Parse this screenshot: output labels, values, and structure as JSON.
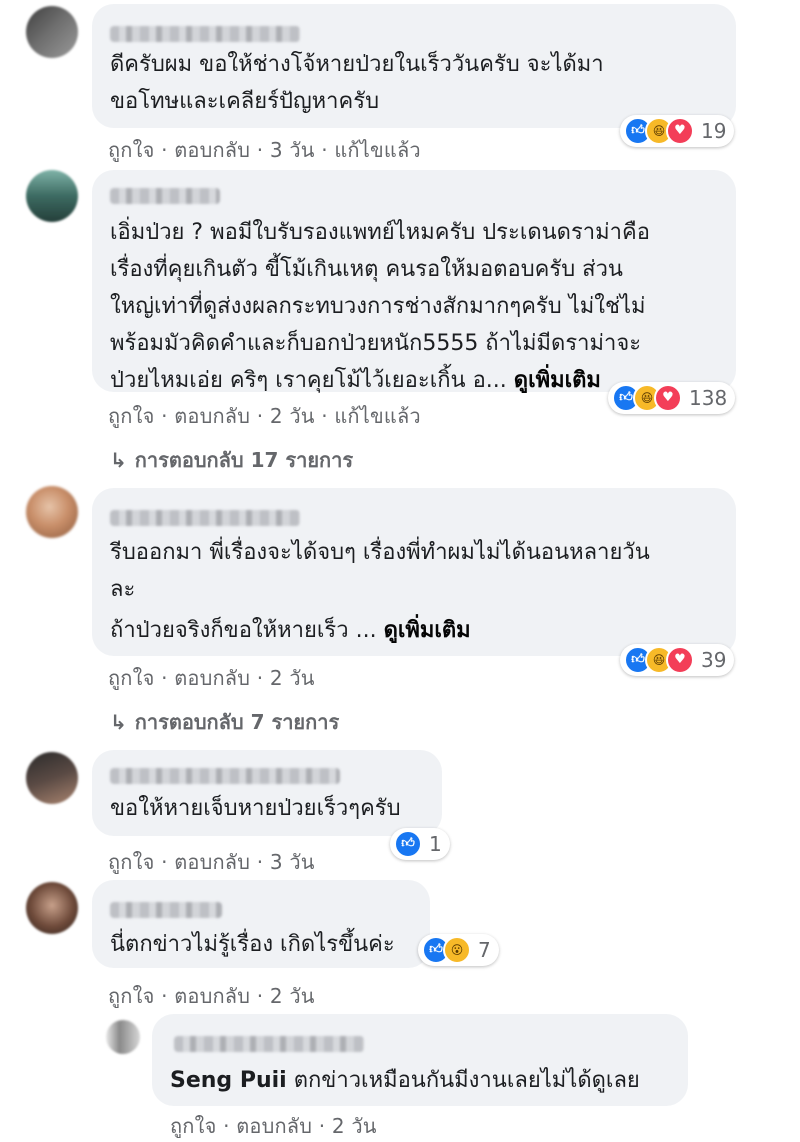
{
  "actions": {
    "like": "ถูกใจ",
    "reply": "ตอบกลับ",
    "sep": "·",
    "edited": "แก้ไขแล้ว"
  },
  "see_more": "ดูเพิ่มเติม",
  "comments": [
    {
      "text": "ดีครับผม ขอให้ช่างโจ้หายป่วยในเร็ววันครับ จะได้มา\nขอโทษและเคลียร์ปัญหาครับ",
      "reactions": {
        "icons": [
          "like-icon",
          "haha-icon",
          "love-icon"
        ],
        "count": "19"
      },
      "time": "3 วัน"
    },
    {
      "text": "เอิ่มป่วย ? พอมีใบรับรองแพทย์ไหมครับ ประเดนดราม่าคือ\nเรื่องที่คุยเกินตัว ขี้โม้เกินเหตุ คนรอให้มอตอบครับ ส่วน\nใหญ่เท่าที่ดูส่งงผลกระทบวงการช่างสักมากๆครับ ไม่ใช่ไม่\nพร้อมมัวคิดคำและก็บอกป่วยหนัก5555 ถ้าไม่มีดราม่าจะ\nป่วยไหมเอ่ย คริๆ เราคุยโม้ไว้เยอะเกิ้น อ...",
      "reactions": {
        "icons": [
          "like-icon",
          "haha-icon",
          "love-icon"
        ],
        "count": "138"
      },
      "time": "2 วัน",
      "replies_label": "การตอบกลับ 17 รายการ"
    },
    {
      "text": "รีบออกมา พี่เรื่องจะได้จบๆ เรื่องพี่ทำผมไม่ได้นอนหลายวัน\nละ",
      "text2": "ถ้าป่วยจริงก็ขอให้หายเร็ว ...",
      "reactions": {
        "icons": [
          "like-icon",
          "haha-icon",
          "love-icon"
        ],
        "count": "39"
      },
      "time": "2 วัน",
      "replies_label": "การตอบกลับ 7 รายการ"
    },
    {
      "text": "ขอให้หายเจ็บหายป่วยเร็วๆครับ",
      "reactions": {
        "icons": [
          "like-icon"
        ],
        "count": "1"
      },
      "time": "3 วัน"
    },
    {
      "text": "นี่ตกข่าวไม่รู้เรื่อง เกิดไรขึ้นค่ะ",
      "reactions": {
        "icons": [
          "like-icon",
          "wow-icon"
        ],
        "count": "7"
      },
      "time": "2 วัน"
    }
  ],
  "reply": {
    "mention": "Seng Puii",
    "text": " ตกข่าวเหมือนกันมีงานเลยไม่ได้ดูเลย",
    "time": "2 วัน"
  },
  "colors": {
    "bubble": "#f0f2f5",
    "meta": "#65676b",
    "like": "#1877f2",
    "love": "#f33e58",
    "haha": "#f7b928"
  }
}
